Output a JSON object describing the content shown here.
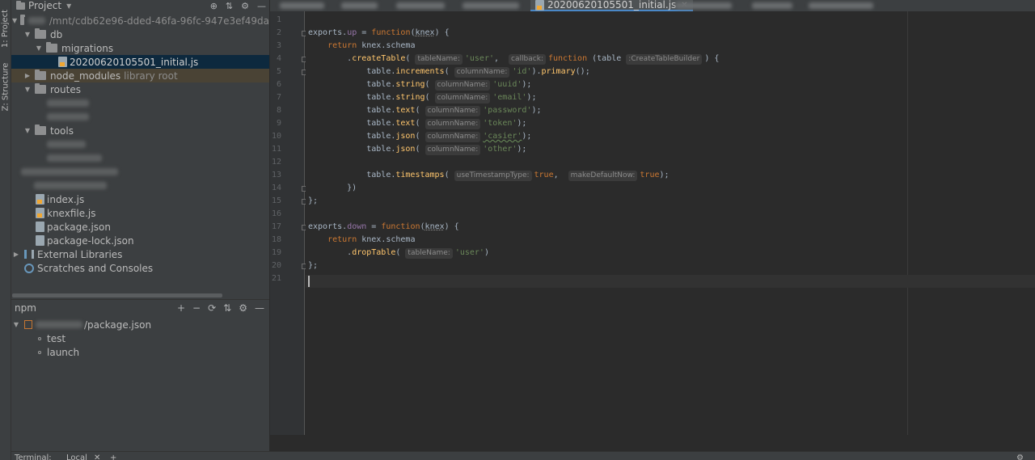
{
  "toolstrip": {
    "project_tab": "1: Project",
    "structure_tab": "Z: Structure"
  },
  "project_panel": {
    "title": "Project",
    "root_path": "/mnt/cdb62e96-dded-46fa-96fc-947e3ef49da",
    "items": [
      {
        "label": "db"
      },
      {
        "label": "migrations"
      },
      {
        "label": "20200620105501_initial.js"
      },
      {
        "label": "node_modules",
        "suffix": "library root"
      },
      {
        "label": "routes"
      },
      {
        "label": "tools"
      },
      {
        "label": "index.js"
      },
      {
        "label": "knexfile.js"
      },
      {
        "label": "package.json"
      },
      {
        "label": "package-lock.json"
      },
      {
        "label": "External Libraries"
      },
      {
        "label": "Scratches and Consoles"
      }
    ]
  },
  "npm_panel": {
    "title": "npm",
    "package": "/package.json",
    "scripts": [
      "test",
      "launch"
    ]
  },
  "editor": {
    "active_tab": "20200620105501_initial.js",
    "line_numbers": [
      "1",
      "2",
      "3",
      "4",
      "5",
      "6",
      "7",
      "8",
      "9",
      "10",
      "11",
      "12",
      "13",
      "14",
      "15",
      "16",
      "17",
      "18",
      "19",
      "20",
      "21"
    ],
    "code": {
      "l2": {
        "obj": "exports",
        "prop": "up",
        "kw": "function",
        "param": "knex"
      },
      "l3": {
        "kw": "return",
        "text": "knex.schema"
      },
      "l4": {
        "method": "createTable",
        "hint1": "tableName:",
        "s1": "'user'",
        "hint2": "callback:",
        "kw": "function",
        "param": "table",
        "hint3": ":CreateTableBuilder"
      },
      "l5": {
        "method": "increments",
        "hint": "columnName:",
        "s": "'id'",
        "method2": "primary"
      },
      "l6": {
        "method": "string",
        "hint": "columnName:",
        "s": "'uuid'"
      },
      "l7": {
        "method": "string",
        "hint": "columnName:",
        "s": "'email'"
      },
      "l8": {
        "method": "text",
        "hint": "columnName:",
        "s": "'password'"
      },
      "l9": {
        "method": "text",
        "hint": "columnName:",
        "s": "'token'"
      },
      "l10": {
        "method": "json",
        "hint": "columnName:",
        "s": "'casier'"
      },
      "l11": {
        "method": "json",
        "hint": "columnName:",
        "s": "'other'"
      },
      "l13": {
        "method": "timestamps",
        "hint1": "useTimestampType:",
        "v1": "true",
        "hint2": "makeDefaultNow:",
        "v2": "true"
      },
      "l17": {
        "obj": "exports",
        "prop": "down",
        "kw": "function",
        "param": "knex"
      },
      "l18": {
        "kw": "return",
        "text": "knex.schema"
      },
      "l19": {
        "method": "dropTable",
        "hint": "tableName:",
        "s": "'user'"
      }
    }
  },
  "bottom_bar": {
    "terminal": "Terminal:",
    "local": "Local"
  }
}
